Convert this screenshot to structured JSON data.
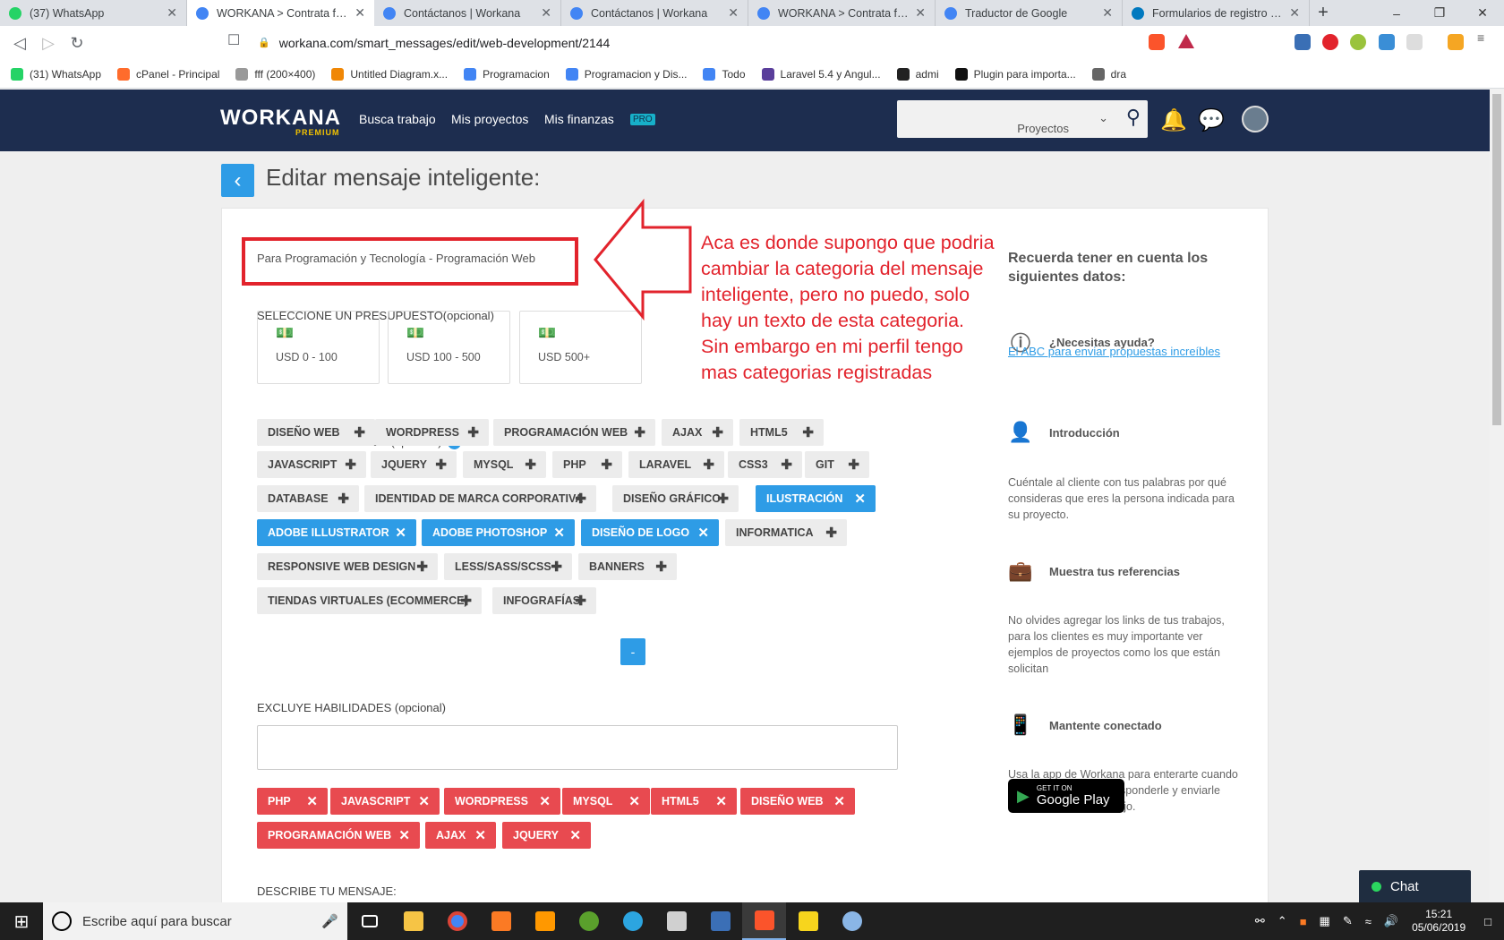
{
  "browser": {
    "tabs": [
      {
        "title": "(37) WhatsApp",
        "color": "#25d366",
        "active": false
      },
      {
        "title": "WORKANA > Contrata freelancers",
        "color": "#4285f4",
        "active": true
      },
      {
        "title": "Contáctanos | Workana",
        "color": "#4285f4",
        "active": false
      },
      {
        "title": "Contáctanos | Workana",
        "color": "#4285f4",
        "active": false
      },
      {
        "title": "WORKANA > Contrata freelancers",
        "color": "#4285f4",
        "active": false
      },
      {
        "title": "Traductor de Google",
        "color": "#4285f4",
        "active": false
      },
      {
        "title": "Formularios de registro en W",
        "color": "#0079bf",
        "active": false
      }
    ],
    "url": "workana.com/smart_messages/edit/web-development/2144",
    "bookmarks": [
      {
        "label": "(31) WhatsApp",
        "color": "#25d366"
      },
      {
        "label": "cPanel - Principal",
        "color": "#ff6c2c"
      },
      {
        "label": "fff (200×400)",
        "color": "#999999"
      },
      {
        "label": "Untitled Diagram.x...",
        "color": "#f08705"
      },
      {
        "label": "Programacion",
        "color": "#4285f4"
      },
      {
        "label": "Programacion y Dis...",
        "color": "#4285f4"
      },
      {
        "label": "Todo",
        "color": "#4285f4"
      },
      {
        "label": "Laravel 5.4 y Angul...",
        "color": "#5a3e9b"
      },
      {
        "label": "admi",
        "color": "#222222"
      },
      {
        "label": "Plugin para importa...",
        "color": "#111111"
      },
      {
        "label": "dra",
        "color": "#666666"
      }
    ]
  },
  "header": {
    "logo": "WORKANA",
    "logo_sub": "PREMIUM",
    "nav": [
      "Busca trabajo",
      "Mis proyectos",
      "Mis finanzas"
    ],
    "pro_badge": "PRO",
    "search_scope": "Proyectos"
  },
  "page": {
    "title": "Editar mensaje inteligente:",
    "category": "Para Programación y Tecnología - Programación Web",
    "budget_label": "SELECCIONE UN PRESUPUESTO(opcional)",
    "budgets": [
      "USD 0 - 100",
      "USD 100 - 500",
      "USD 500+"
    ],
    "include_label": "INCLUYE HABILIDADES (opcional)",
    "include_skills": [
      {
        "label": "DISEÑO WEB",
        "selected": false
      },
      {
        "label": "WORDPRESS",
        "selected": false
      },
      {
        "label": "PROGRAMACIÓN WEB",
        "selected": false
      },
      {
        "label": "AJAX",
        "selected": false
      },
      {
        "label": "HTML5",
        "selected": false
      },
      {
        "label": "JAVASCRIPT",
        "selected": false
      },
      {
        "label": "JQUERY",
        "selected": false
      },
      {
        "label": "MYSQL",
        "selected": false
      },
      {
        "label": "PHP",
        "selected": false
      },
      {
        "label": "LARAVEL",
        "selected": false
      },
      {
        "label": "CSS3",
        "selected": false
      },
      {
        "label": "GIT",
        "selected": false
      },
      {
        "label": "DATABASE",
        "selected": false
      },
      {
        "label": "IDENTIDAD DE MARCA CORPORATIVA",
        "selected": false
      },
      {
        "label": "DISEÑO GRÁFICO",
        "selected": false
      },
      {
        "label": "ILUSTRACIÓN",
        "selected": true
      },
      {
        "label": "ADOBE ILLUSTRATOR",
        "selected": true
      },
      {
        "label": "ADOBE PHOTOSHOP",
        "selected": true
      },
      {
        "label": "DISEÑO DE LOGO",
        "selected": true
      },
      {
        "label": "INFORMATICA",
        "selected": false
      },
      {
        "label": "RESPONSIVE WEB DESIGN",
        "selected": false
      },
      {
        "label": "LESS/SASS/SCSS",
        "selected": false
      },
      {
        "label": "BANNERS",
        "selected": false
      },
      {
        "label": "TIENDAS VIRTUALES (ECOMMERCE)",
        "selected": false
      },
      {
        "label": "INFOGRAFÍAS",
        "selected": false
      }
    ],
    "collapse_label": "-",
    "exclude_label": "EXCLUYE HABILIDADES (opcional)",
    "exclude_skills": [
      "PHP",
      "JAVASCRIPT",
      "WORDPRESS",
      "MYSQL",
      "HTML5",
      "DISEÑO WEB",
      "PROGRAMACIÓN WEB",
      "AJAX",
      "JQUERY"
    ],
    "describe_label": "DESCRIBE TU MENSAJE:"
  },
  "sidebar": {
    "title": "Recuerda tener en cuenta los siguientes datos:",
    "help_heading": "¿Necesitas ayuda?",
    "help_link": "El ABC para enviar propuestas increíbles",
    "sections": [
      {
        "heading": "Introducción",
        "text": "Cuéntale al cliente con tus palabras por qué consideras que eres la persona indicada para su proyecto."
      },
      {
        "heading": "Muestra tus referencias",
        "text": "No olvides agregar los links de tus trabajos, para los clientes es muy importante ver ejemplos de proyectos como los que están solicitan"
      },
      {
        "heading": "Mantente conectado",
        "text": "Usa la app de Workana para enterarte cuando te escribe el cliente, responderle y enviarle una propuesta de trabajo."
      }
    ],
    "badge_small": "GET IT ON",
    "badge_big": "Google Play"
  },
  "chat_label": "Chat",
  "annotation": "Aca es donde supongo que podria cambiar la categoria del mensaje inteligente, pero no puedo, solo hay un texto de esta categoria. Sin embargo en mi perfil tengo mas categorias registradas",
  "taskbar": {
    "search_placeholder": "Escribe aquí para buscar",
    "time": "15:21",
    "date": "05/06/2019"
  }
}
